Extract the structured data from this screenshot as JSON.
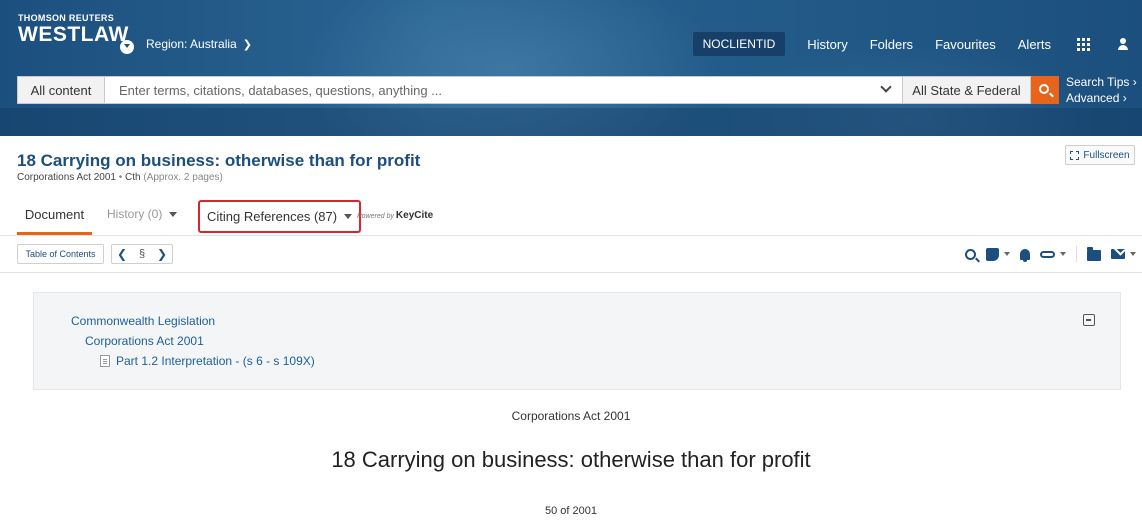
{
  "header": {
    "brand_top": "THOMSON REUTERS",
    "brand_name": "WESTLAW",
    "region_label": "Region: Australia",
    "client_id": "NOCLIENTID",
    "nav": [
      "History",
      "Folders",
      "Favourites",
      "Alerts"
    ],
    "icons": [
      "apps-grid-icon",
      "user-icon"
    ]
  },
  "search": {
    "scope": "All content",
    "placeholder": "Enter terms, citations, databases, questions, anything ...",
    "jurisdiction": "All State & Federal",
    "tips_label": "Search Tips",
    "advanced_label": "Advanced",
    "accent_color": "#e8641b"
  },
  "document": {
    "title": "18 Carrying on business: otherwise than for profit",
    "act": "Corporations Act 2001",
    "jurisdiction": "Cth",
    "pages": "(Approx. 2 pages)",
    "fullscreen_label": "Fullscreen"
  },
  "tabs": {
    "document": "Document",
    "history": "History (0)",
    "citing": "Citing References (87)",
    "powered_by": "Powered by",
    "keycite": "KeyCite"
  },
  "toolbar": {
    "toc_label": "Table of Contents",
    "section_symbol": "§",
    "tools": [
      "search-icon",
      "note-icon",
      "bell-icon",
      "link-icon",
      "folder-icon",
      "mail-icon"
    ]
  },
  "breadcrumbs": {
    "level1": "Commonwealth Legislation",
    "level2": "Corporations Act 2001",
    "level3": "Part 1.2 Interpretation - (s 6 - s 109X)"
  },
  "body": {
    "act_name": "Corporations Act 2001",
    "section_heading": "18 Carrying on business: otherwise than for profit",
    "act_number": "50 of 2001"
  },
  "colors": {
    "header_blue": "#1c4f7e",
    "link_blue": "#1c5f9a",
    "highlight_red": "#d9262e"
  }
}
